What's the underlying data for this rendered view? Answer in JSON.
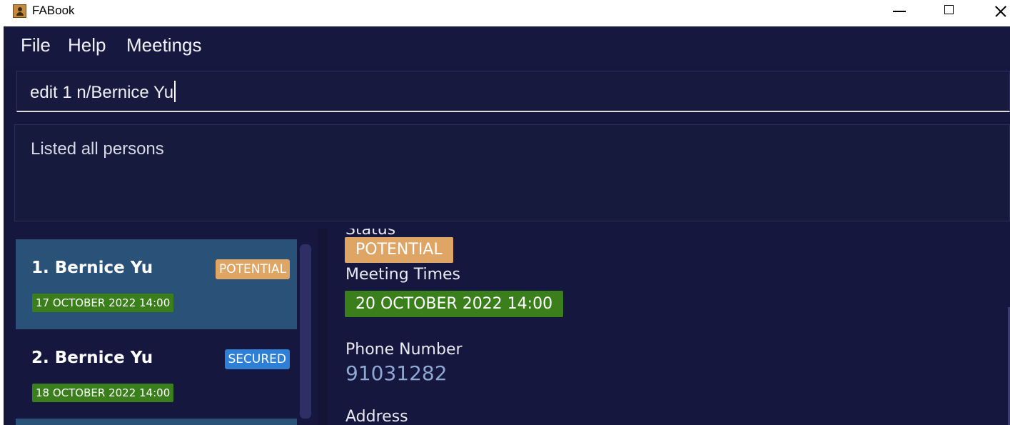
{
  "window": {
    "title": "FABook"
  },
  "menu": {
    "file": "File",
    "help": "Help",
    "meetings": "Meetings"
  },
  "command": {
    "value": "edit 1 n/Bernice Yu"
  },
  "result": {
    "text": "Listed all persons"
  },
  "persons": [
    {
      "index_name": "1.  Bernice Yu",
      "status": "POTENTIAL",
      "meeting": "17 OCTOBER 2022 14:00",
      "selected": true
    },
    {
      "index_name": "2.  Bernice Yu",
      "status": "SECURED",
      "meeting": "18 OCTOBER 2022 14:00",
      "selected": false
    }
  ],
  "detail": {
    "status_label": "Status",
    "status": "POTENTIAL",
    "meeting_label": "Meeting Times",
    "meeting": "20 OCTOBER 2022 14:00",
    "phone_label": "Phone Number",
    "phone": "91031282",
    "address_label": "Address"
  },
  "colors": {
    "background": "#16173e",
    "selected_card": "#2a5178",
    "potential": "#dea564",
    "secured": "#2e7fd5",
    "meeting": "#3a7f1c",
    "phone": "#8ea8d2"
  },
  "icons": {
    "app": "address-book-icon",
    "minimize": "minimize-icon",
    "maximize": "maximize-icon",
    "close": "close-icon"
  }
}
